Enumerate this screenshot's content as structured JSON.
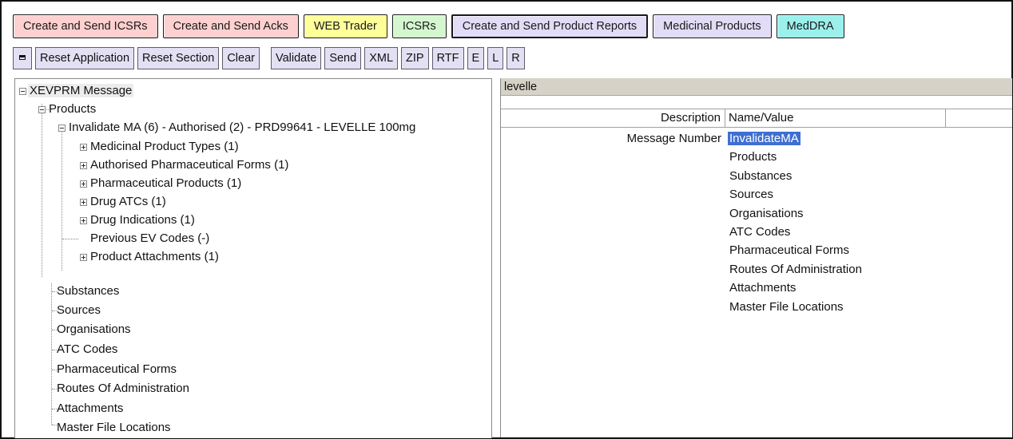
{
  "tabs": [
    {
      "label": "Create and Send ICSRs"
    },
    {
      "label": "Create and Send Acks"
    },
    {
      "label": "WEB Trader"
    },
    {
      "label": "ICSRs"
    },
    {
      "label": "Create and Send Product Reports"
    },
    {
      "label": "Medicinal Products"
    },
    {
      "label": "MedDRA"
    }
  ],
  "toolbar": {
    "reset_application": "Reset Application",
    "reset_section": "Reset Section",
    "clear": "Clear",
    "validate": "Validate",
    "send": "Send",
    "xml": "XML",
    "zip": "ZIP",
    "rtf": "RTF",
    "e": "E",
    "l": "L",
    "r": "R"
  },
  "tree": {
    "root": "XEVPRM Message",
    "products": "Products",
    "product": "Invalidate MA (6) - Authorised (2) - PRD99641 - LEVELLE 100mg",
    "product_children": [
      {
        "label": "Medicinal Product Types (1)"
      },
      {
        "label": "Authorised Pharmaceutical Forms (1)"
      },
      {
        "label": "Pharmaceutical Products (1)"
      },
      {
        "label": "Drug ATCs (1)"
      },
      {
        "label": "Drug Indications (1)"
      },
      {
        "label": "Previous EV Codes (-)"
      },
      {
        "label": "Product Attachments (1)"
      }
    ],
    "sections": [
      {
        "label": "Substances"
      },
      {
        "label": "Sources"
      },
      {
        "label": "Organisations"
      },
      {
        "label": "ATC Codes"
      },
      {
        "label": "Pharmaceutical Forms"
      },
      {
        "label": "Routes Of Administration"
      },
      {
        "label": "Attachments"
      },
      {
        "label": "Master File Locations"
      }
    ]
  },
  "detail": {
    "search_value": "levelle",
    "col_description": "Description",
    "col_name_value": "Name/Value",
    "row_label": "Message Number",
    "values": [
      {
        "label": "InvalidateMA"
      },
      {
        "label": "Products"
      },
      {
        "label": "Substances"
      },
      {
        "label": "Sources"
      },
      {
        "label": "Organisations"
      },
      {
        "label": "ATC Codes"
      },
      {
        "label": "Pharmaceutical Forms"
      },
      {
        "label": "Routes Of Administration"
      },
      {
        "label": "Attachments"
      },
      {
        "label": "Master File Locations"
      }
    ]
  }
}
